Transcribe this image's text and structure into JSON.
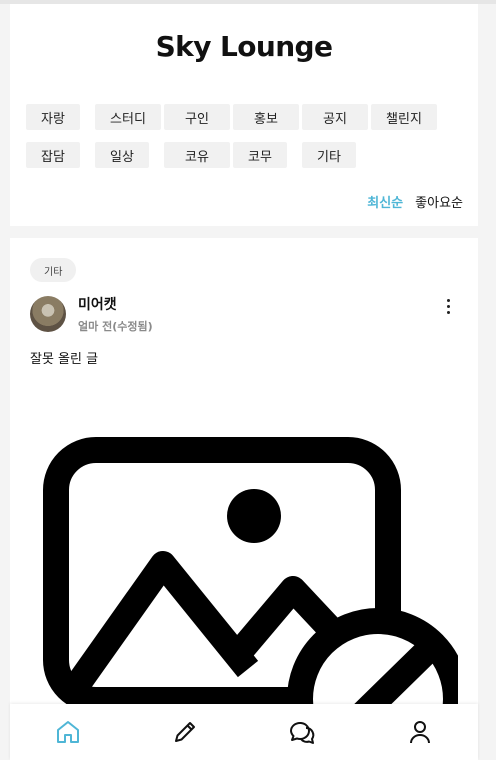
{
  "header": {
    "title": "Sky Lounge"
  },
  "categories": [
    {
      "label": "자랑"
    },
    {
      "label": "스터디"
    },
    {
      "label": "구인"
    },
    {
      "label": "홍보"
    },
    {
      "label": "공지"
    },
    {
      "label": "챌린지"
    },
    {
      "label": "잡담"
    },
    {
      "label": "일상"
    },
    {
      "label": "코유"
    },
    {
      "label": "코무"
    },
    {
      "label": "기타"
    }
  ],
  "sort": {
    "latest": "최신순",
    "likes": "좋아요순",
    "active": "latest"
  },
  "post": {
    "tag": "기타",
    "author": "미어캣",
    "time": "얼마 전(수정됨)",
    "text": "잘못 올린 글",
    "image_icon": "broken-image-icon"
  },
  "nav": [
    {
      "icon": "home-icon",
      "active": true
    },
    {
      "icon": "pencil-icon",
      "active": false
    },
    {
      "icon": "chat-icon",
      "active": false
    },
    {
      "icon": "user-icon",
      "active": false
    }
  ],
  "colors": {
    "accent": "#4fb6d6",
    "background": "#f4f4f4"
  }
}
